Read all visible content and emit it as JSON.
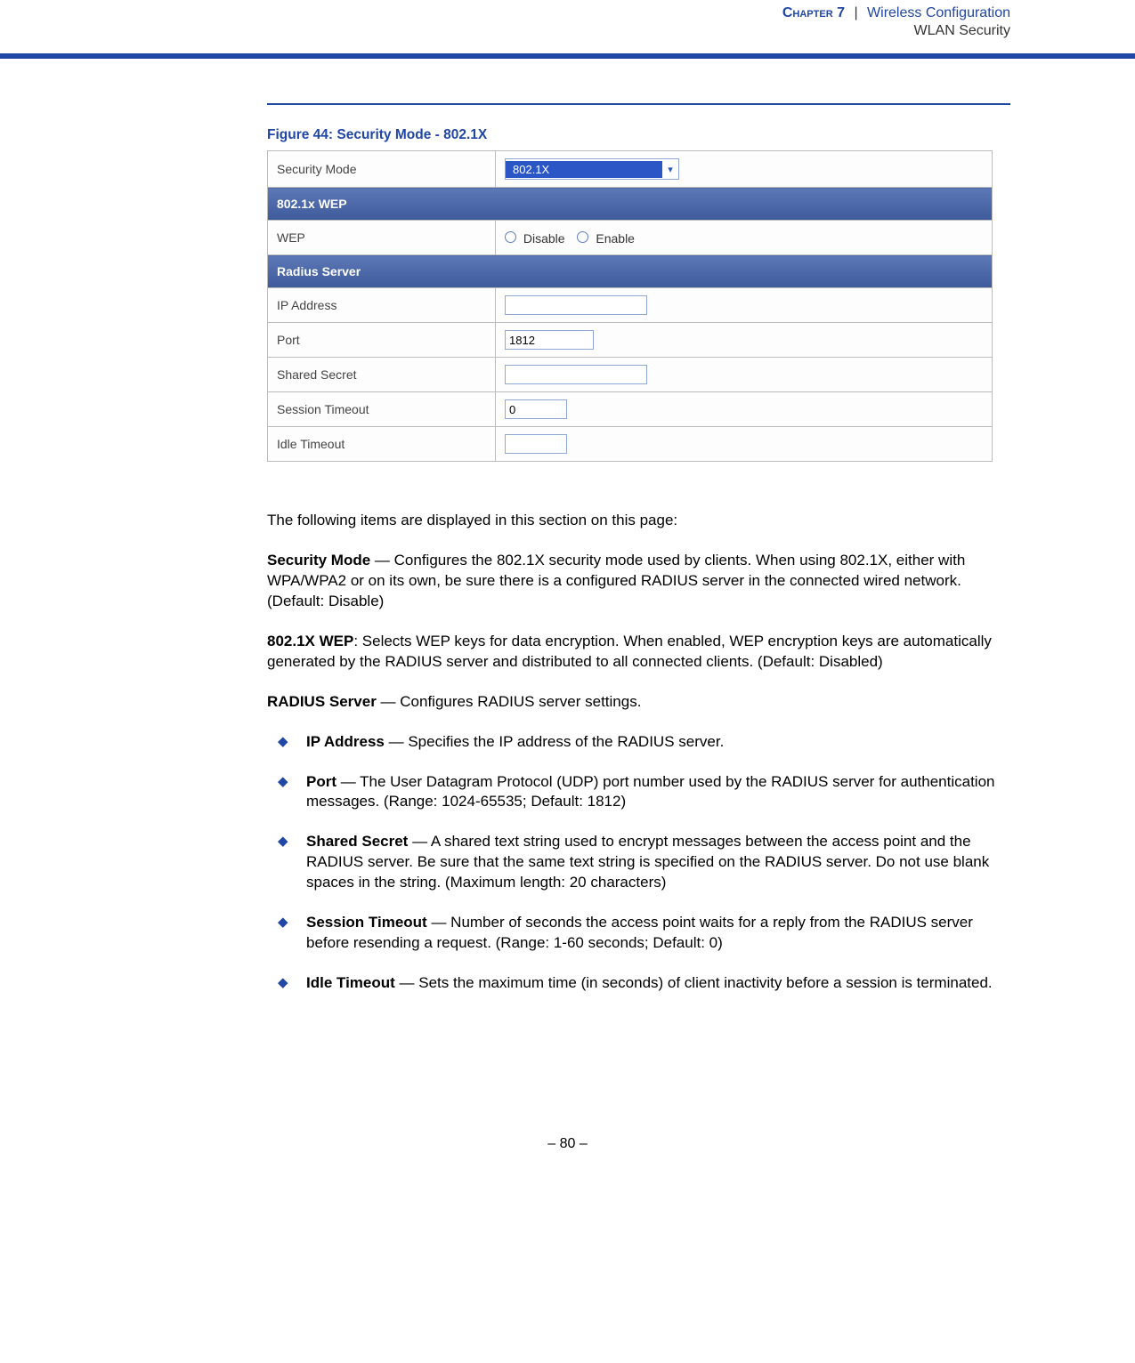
{
  "header": {
    "chapter": "Chapter 7",
    "sep": "|",
    "section": "Wireless Configuration",
    "subsection": "WLAN Security"
  },
  "figure": {
    "caption": "Figure 44:  Security Mode - 802.1X"
  },
  "form": {
    "securityModeLabel": "Security Mode",
    "securityModeValue": "802.1X",
    "section1": "802.1x WEP",
    "wepLabel": "WEP",
    "wepDisable": "Disable",
    "wepEnable": "Enable",
    "section2": "Radius Server",
    "ipLabel": "IP Address",
    "ipValue": "",
    "portLabel": "Port",
    "portValue": "1812",
    "secretLabel": "Shared Secret",
    "secretValue": "",
    "sessionLabel": "Session Timeout",
    "sessionValue": "0",
    "idleLabel": "Idle Timeout",
    "idleValue": ""
  },
  "text": {
    "intro": "The following items are displayed in this section on this page:",
    "p1_term": "Security Mode",
    "p1_body": " — Configures the 802.1X security mode used by clients. When using 802.1X, either with WPA/WPA2 or on its own, be sure there is a configured RADIUS server in the connected wired network. (Default: Disable)",
    "p2_term": "802.1X WEP",
    "p2_body": ": Selects WEP keys for data encryption. When enabled, WEP encryption keys are automatically generated by the RADIUS server and distributed to all connected clients. (Default: Disabled)",
    "p3_term": "RADIUS Server",
    "p3_body": " — Configures RADIUS server settings.",
    "li1_term": "IP Address",
    "li1_body": " — Specifies the IP address of the RADIUS server.",
    "li2_term": "Port",
    "li2_body": " — The User Datagram Protocol (UDP) port number used by the RADIUS server for authentication messages. (Range: 1024-65535; Default: 1812)",
    "li3_term": "Shared Secret",
    "li3_body": " — A shared text string used to encrypt messages between the access point and the RADIUS server. Be sure that the same text string is specified on the RADIUS server. Do not use blank spaces in the string. (Maximum length: 20 characters)",
    "li4_term": "Session Timeout",
    "li4_body": " — Number of seconds the access point waits for a reply from the RADIUS server before resending a request. (Range: 1-60 seconds; Default: 0)",
    "li5_term": "Idle Timeout",
    "li5_body": " — Sets the maximum time (in seconds) of client inactivity before a session is terminated."
  },
  "footer": {
    "page": "–  80  –"
  }
}
